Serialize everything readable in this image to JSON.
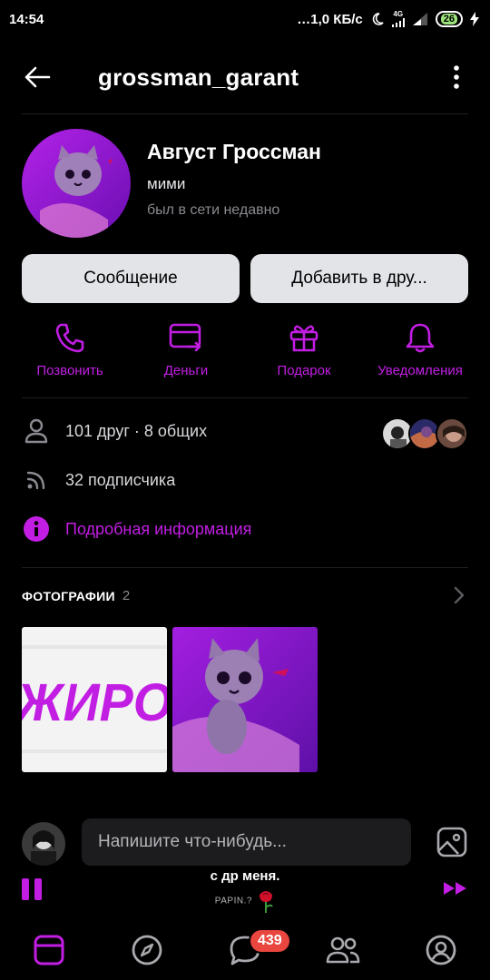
{
  "status_bar": {
    "time": "14:54",
    "network_speed": "…1,0 КБ/с",
    "network_type": "4G",
    "battery": "26"
  },
  "header": {
    "username": "grossman_garant"
  },
  "profile": {
    "name": "Август Гроссман",
    "status": "мими",
    "last_seen": "был в сети недавно"
  },
  "buttons": {
    "message": "Сообщение",
    "add_friend": "Добавить в дру..."
  },
  "actions": [
    {
      "label": "Позвонить",
      "icon": "phone-icon"
    },
    {
      "label": "Деньги",
      "icon": "money-card-icon"
    },
    {
      "label": "Подарок",
      "icon": "gift-icon"
    },
    {
      "label": "Уведомления",
      "icon": "bell-icon"
    }
  ],
  "info": {
    "friends": "101 друг · 8 общих",
    "followers": "32 подписчика",
    "details": "Подробная информация"
  },
  "photos": {
    "title": "ФОТОГРАФИИ",
    "count": "2",
    "photo1_text": "ЖИРО"
  },
  "comment": {
    "placeholder": "Напишите что-нибудь..."
  },
  "player": {
    "title": "с др меня.",
    "artist": "PAPIN.?"
  },
  "nav": {
    "messages_badge": "439"
  },
  "colors": {
    "accent": "#c21ee3",
    "background": "#000000",
    "button_bg": "#e3e4e8",
    "badge": "#e8463f"
  }
}
